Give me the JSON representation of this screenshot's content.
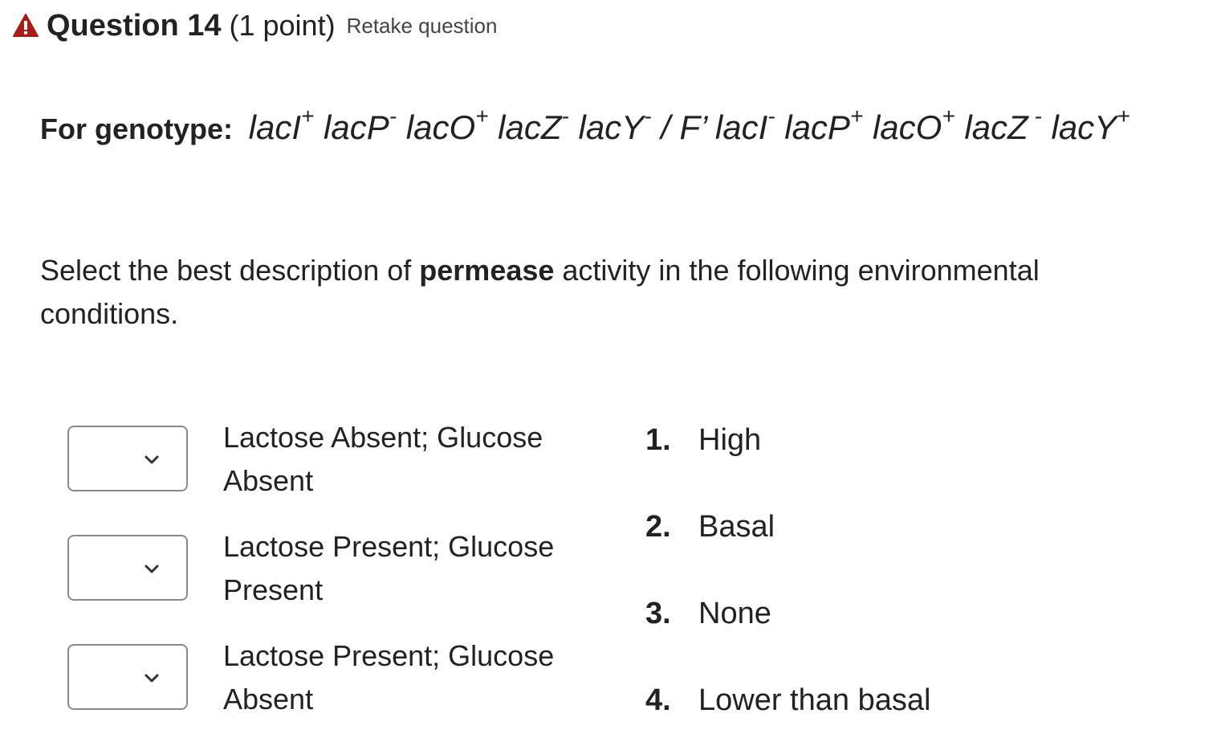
{
  "header": {
    "icon": "warning-icon",
    "icon_color": "#a3201a",
    "title": "Question 14",
    "points": "(1 point)",
    "retake": "Retake question"
  },
  "question": {
    "genotype_lead": "For genotype:",
    "genotype_parts": [
      {
        "base": "lacI",
        "sup": "+"
      },
      {
        "base": " lacP",
        "sup": "-"
      },
      {
        "base": " lacO",
        "sup": "+"
      },
      {
        "base": " lacZ",
        "sup": "-"
      },
      {
        "base": " lacY",
        "sup": "-"
      },
      {
        "base": " / F’ lacI",
        "sup": "-"
      },
      {
        "base": " lacP",
        "sup": "+"
      },
      {
        "base": " lacO",
        "sup": "+"
      },
      {
        "base": " lacZ",
        "sup": " -"
      },
      {
        "base": " lacY",
        "sup": "+"
      }
    ],
    "instruction_pre": "Select the best description of ",
    "instruction_bold": "permease",
    "instruction_post": " activity in the following environmental conditions."
  },
  "matching": {
    "rows": [
      {
        "condition": "Lactose Absent; Glucose Absent",
        "selected": ""
      },
      {
        "condition": "Lactose Present; Glucose Present",
        "selected": ""
      },
      {
        "condition": "Lactose Present; Glucose Absent",
        "selected": ""
      }
    ],
    "options": [
      {
        "num": "1.",
        "label": "High"
      },
      {
        "num": "2.",
        "label": "Basal"
      },
      {
        "num": "3.",
        "label": "None"
      },
      {
        "num": "4.",
        "label": "Lower than basal"
      }
    ]
  }
}
